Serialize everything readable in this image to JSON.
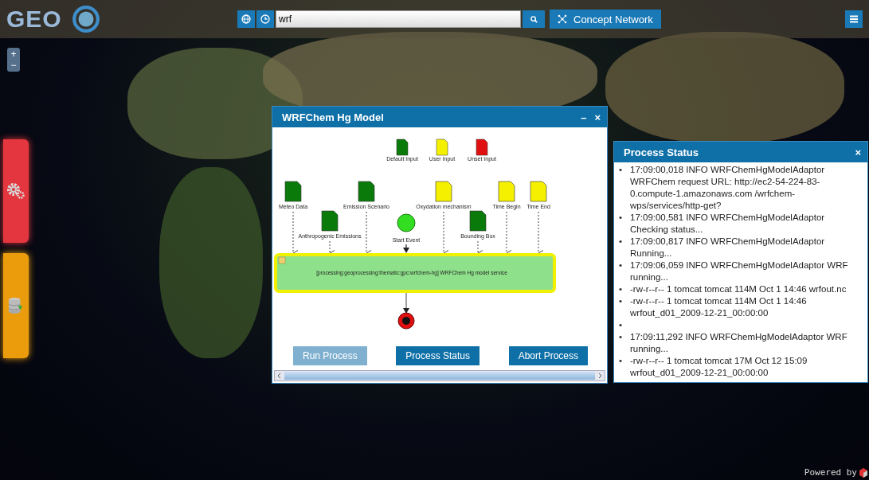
{
  "top_bar": {
    "logo_text": "GEO",
    "search": {
      "value": "wrf"
    },
    "concept_button": "Concept Network"
  },
  "zoom": {
    "plus": "+",
    "minus": "−"
  },
  "model_window": {
    "title": "WRFChem Hg Model",
    "minimize": "–",
    "close": "×",
    "legend": [
      {
        "kind": "default",
        "label": "Default Input"
      },
      {
        "kind": "user",
        "label": "User Input"
      },
      {
        "kind": "unset",
        "label": "Unset Input"
      }
    ],
    "inputs": [
      {
        "kind": "default",
        "label": "Meteo Data"
      },
      {
        "kind": "default",
        "label": "Anthropogenic Emissions"
      },
      {
        "kind": "default",
        "label": "Emission Scenario"
      },
      {
        "kind": "user",
        "label": "Oxydation mechanism"
      },
      {
        "kind": "default",
        "label": "Bounding Box"
      },
      {
        "kind": "user",
        "label": "Time Begin"
      },
      {
        "kind": "user",
        "label": "Time End"
      }
    ],
    "start_event": "Start Event",
    "process": "[processing:geoprocessing:thematic:gpc:wrfchem-hg] WRFChem Hg model service",
    "buttons": [
      {
        "label": "Run Process",
        "disabled": true
      },
      {
        "label": "Process Status",
        "disabled": false
      },
      {
        "label": "Abort Process",
        "disabled": false
      }
    ]
  },
  "status_window": {
    "title": "Process Status",
    "close": "×",
    "log": [
      {
        "bullet": "•",
        "text": "17:09:00,018 INFO WRFChemHgModelAdaptor WRFChem request URL: http://ec2-54-224-83-0.compute-1.amazonaws.com /wrfchem-wps/services/http-get?"
      },
      {
        "bullet": "•",
        "text": "17:09:00,581 INFO WRFChemHgModelAdaptor Checking status..."
      },
      {
        "bullet": "•",
        "text": "17:09:00,817 INFO WRFChemHgModelAdaptor Running..."
      },
      {
        "bullet": "•",
        "text": "17:09:06,059 INFO WRFChemHgModelAdaptor WRF running..."
      },
      {
        "bullet": "•",
        "text": "-rw-r--r-- 1 tomcat tomcat 114M Oct 1 14:46 wrfout.nc"
      },
      {
        "bullet": "•",
        "text": "-rw-r--r-- 1 tomcat tomcat 114M Oct 1 14:46 wrfout_d01_2009-12-21_00:00:00"
      },
      {
        "bullet": "•"
      },
      {
        "bullet": "•",
        "text": "17:09:11,292 INFO WRFChemHgModelAdaptor WRF running..."
      },
      {
        "bullet": "•",
        "text": "-rw-r--r-- 1 tomcat tomcat 17M Oct 12 15:09 wrfout_d01_2009-12-21_00:00:00"
      }
    ]
  },
  "footer": {
    "powered_by": "Powered by"
  }
}
